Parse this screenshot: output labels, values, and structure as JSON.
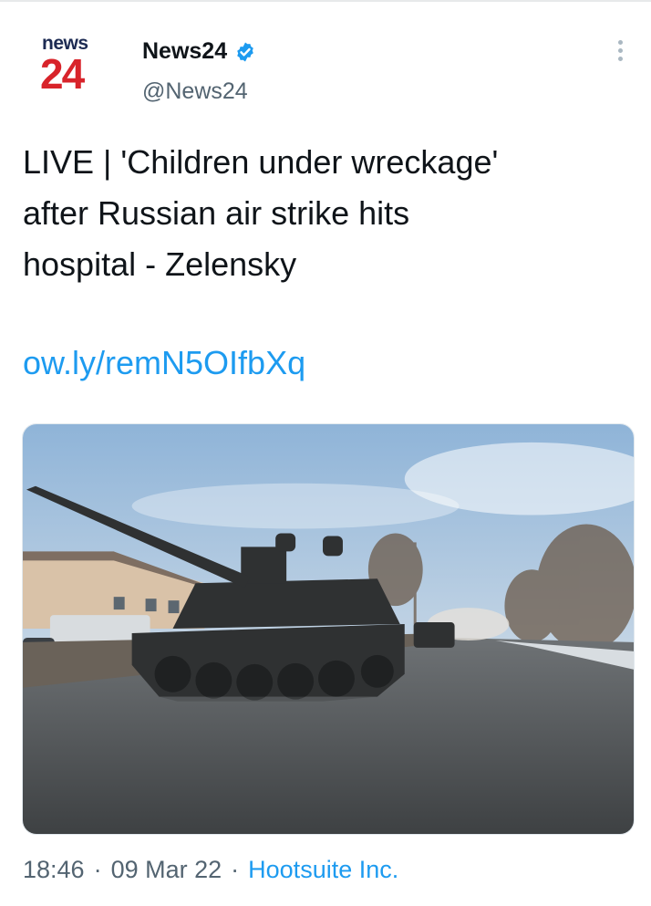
{
  "account": {
    "logo_top": "news",
    "logo_bottom": "24",
    "display_name": "News24",
    "handle": "@News24"
  },
  "tweet": {
    "text": "LIVE | 'Children under wreckage'\nafter Russian air strike hits\nhospital - Zelensky",
    "link": "ow.ly/remN5OIfbXq",
    "media_alt": "Tanks driving on a road",
    "time": "18:46",
    "date": "09 Mar 22",
    "source": "Hootsuite Inc.",
    "separator": "·"
  },
  "colors": {
    "accent": "#1d9bf0",
    "logo_red": "#d8232a",
    "logo_navy": "#1d2b53",
    "muted": "#536471"
  },
  "icons": {
    "verified": "verified-badge-icon",
    "more": "more-vertical-icon"
  }
}
